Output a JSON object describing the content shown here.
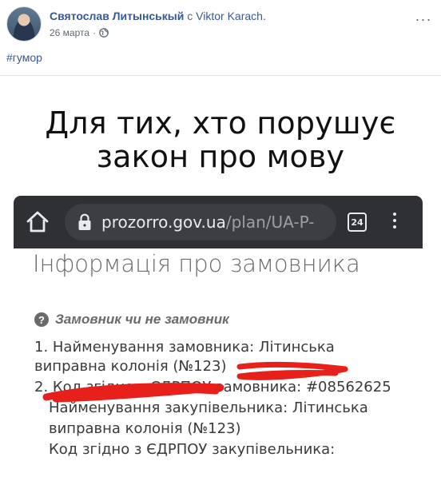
{
  "post": {
    "author": "Святослав Литынськый",
    "with_word": "с",
    "tagged_user": "Viktor Karach.",
    "date": "26 марта",
    "separator": "·",
    "hashtag": "#гумор",
    "more_label": "···",
    "privacy_icon": "globe-icon"
  },
  "meme": {
    "title_line1": "Для тих, хто порушує",
    "title_line2": "закон про мову",
    "browser": {
      "url_host": "prozorro.gov.ua",
      "url_path": "/plan/UA-P-",
      "tab_count": "24",
      "home_icon": "home-icon",
      "lock_icon": "lock-icon",
      "menu_icon": "vertical-dots-icon"
    },
    "page": {
      "heading": "Інформація про замовника",
      "question_icon": "?",
      "question": "Замовник чи не замовник",
      "line1": "1. Найменування замовника: Літинська",
      "line2": "виправна колонія (№123)",
      "line3": "2. Код згідно з ЄДРПОУ замовника: #08562625",
      "line4": "Найменування закупівельника: Літинська",
      "line5": "виправна колонія (№123)",
      "line6": "Код згідно з ЄДРПОУ закупівельника:"
    },
    "redaction_color": "#e8201b"
  },
  "colors": {
    "link_blue": "#385898",
    "browser_bar": "#2f3033",
    "url_pill": "#3d3e41"
  }
}
